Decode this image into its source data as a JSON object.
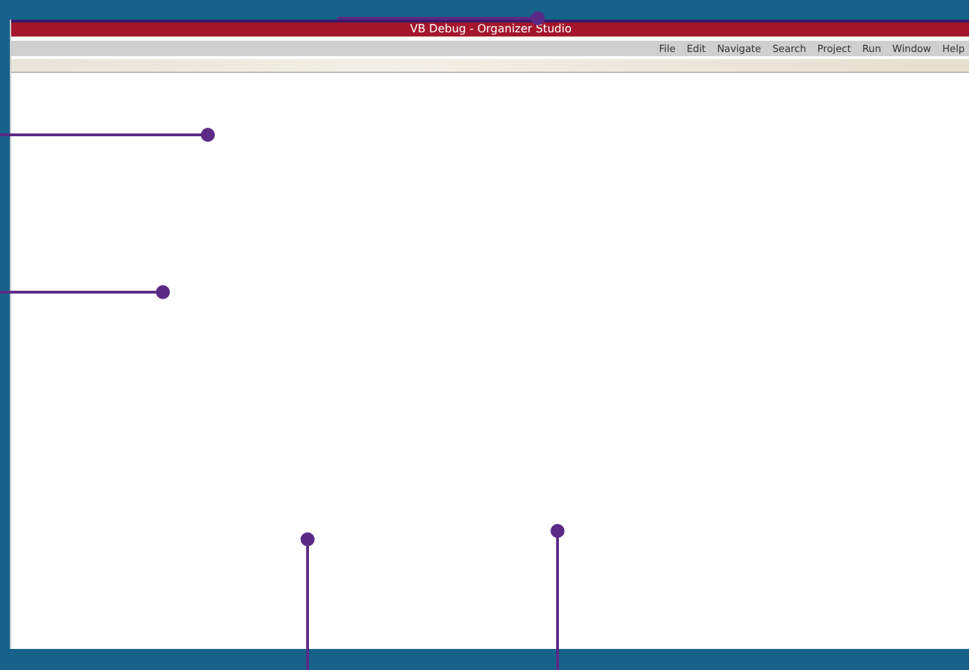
{
  "window": {
    "title": "VB Debug - Organizer Studio"
  },
  "menu": [
    {
      "label": "File"
    },
    {
      "label": "Edit"
    },
    {
      "label": "Navigate"
    },
    {
      "label": "Search"
    },
    {
      "label": "Project"
    },
    {
      "label": "Run"
    },
    {
      "label": "Window"
    },
    {
      "label": "Help"
    }
  ]
}
